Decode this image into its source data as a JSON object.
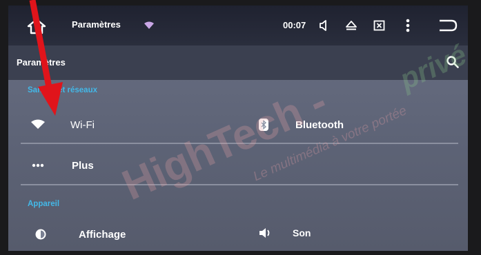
{
  "status_bar": {
    "app_title": "Paramètres",
    "time": "00:07"
  },
  "title_bar": {
    "title": "Paramètres"
  },
  "sections": {
    "network": {
      "header": "Sans fil et réseaux",
      "wifi_label": "Wi-Fi",
      "bluetooth_label": "Bluetooth",
      "more_label": "Plus"
    },
    "device": {
      "header": "Appareil",
      "display_label": "Affichage",
      "sound_label": "Son"
    }
  },
  "watermark": {
    "brand": "HighTech -",
    "tagline": "Le multimédia à votre portée",
    "partial": "privé"
  },
  "colors": {
    "status_bar": "#1f2230",
    "title_bar": "#3b4050",
    "section_header": "#43b8e8",
    "annotation_arrow": "#e0141b"
  }
}
